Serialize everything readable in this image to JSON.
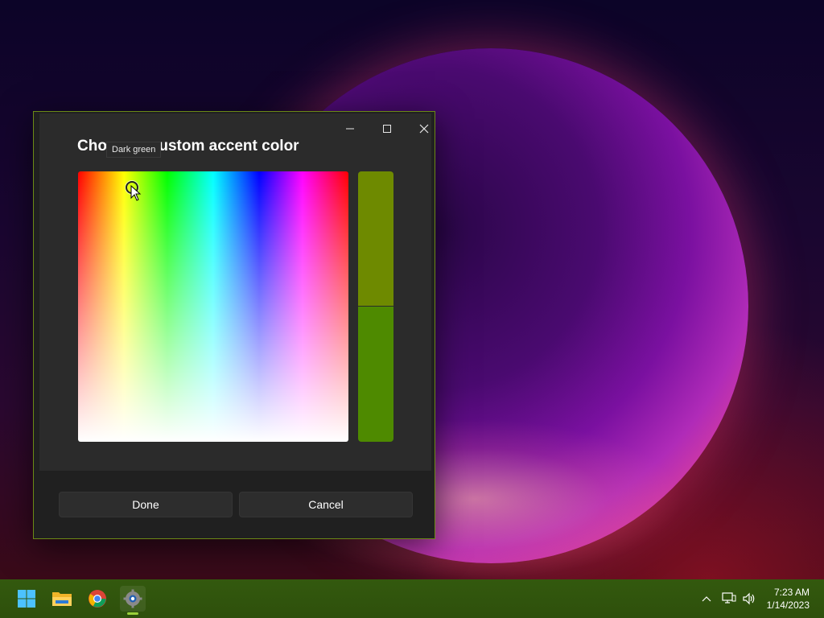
{
  "dialog": {
    "title": "Choose a custom accent color",
    "tooltip": "Dark green",
    "selected_color": "#6e8a00",
    "previous_color": "#4e8a00"
  },
  "buttons": {
    "done": "Done",
    "cancel": "Cancel"
  },
  "window_controls": {
    "minimize_icon": "minimize-icon",
    "maximize_icon": "maximize-icon",
    "close_icon": "close-icon"
  },
  "taskbar": {
    "apps": [
      "windows-start-icon",
      "file-explorer-icon",
      "chrome-icon",
      "settings-icon"
    ],
    "tray_icons": [
      "chevron-up-icon",
      "network-icon",
      "volume-icon"
    ],
    "time": "7:23 AM",
    "date": "1/14/2023"
  },
  "colors": {
    "accent_border": "#6b8a16",
    "taskbar_bg": "#2e500c"
  }
}
